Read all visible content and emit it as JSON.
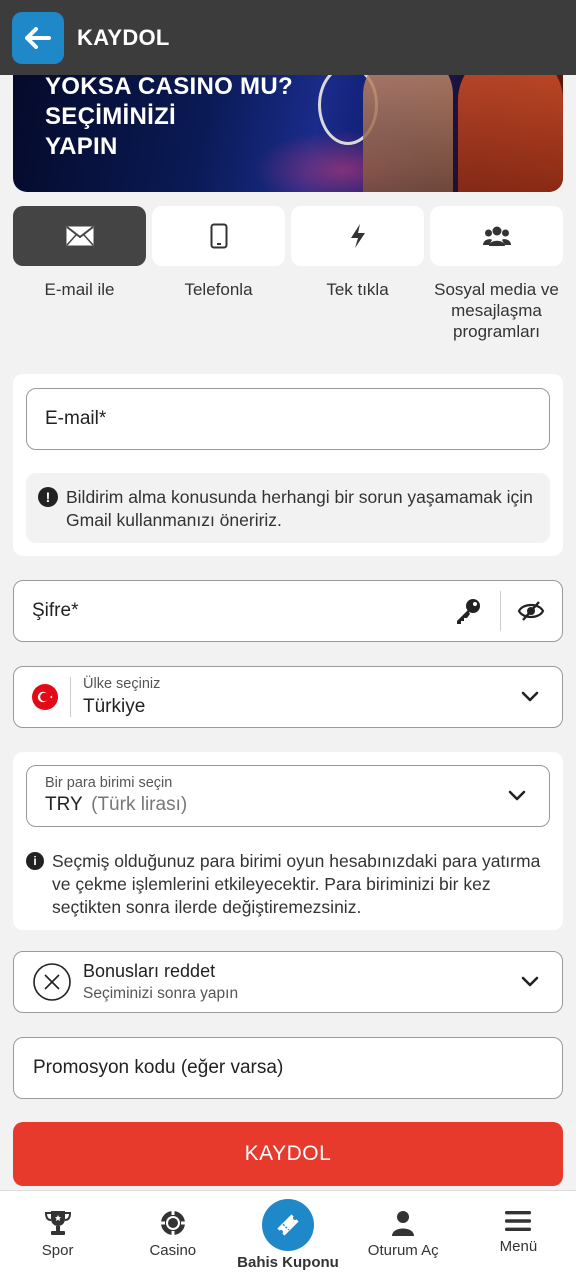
{
  "header": {
    "title": "KAYDOL"
  },
  "banner": {
    "line1": "YOKSA CASINO MU?",
    "line2": "SEÇİMİNİZİ",
    "line3": "YAPIN"
  },
  "tabs": [
    {
      "label": "E-mail ile",
      "icon": "envelope-icon",
      "active": true
    },
    {
      "label": "Telefonla",
      "icon": "phone-icon",
      "active": false
    },
    {
      "label": "Tek tıkla",
      "icon": "lightning-icon",
      "active": false
    },
    {
      "label": "Sosyal media ve mesajlaşma programları",
      "icon": "users-icon",
      "active": false
    }
  ],
  "email": {
    "placeholder": "E-mail*",
    "notice": "Bildirim alma konusunda herhangi bir sorun yaşamamak için Gmail kullanmanızı öneririz."
  },
  "password": {
    "placeholder": "Şifre*"
  },
  "country": {
    "label": "Ülke seçiniz",
    "value": "Türkiye"
  },
  "currency": {
    "label": "Bir para birimi seçin",
    "code": "TRY",
    "name": "(Türk lirası)",
    "notice": "Seçmiş olduğunuz para birimi oyun hesabınızdaki para yatırma ve çekme işlemlerini etkileyecektir. Para biriminizi bir kez seçtikten sonra ilerde değiştiremezsiniz."
  },
  "bonus": {
    "title": "Bonusları reddet",
    "subtitle": "Seçiminizi sonra yapın"
  },
  "promo": {
    "placeholder": "Promosyon kodu (eğer varsa)"
  },
  "submit_label": "KAYDOL",
  "nav": [
    {
      "label": "Spor",
      "icon": "trophy-icon"
    },
    {
      "label": "Casino",
      "icon": "casino-chip-icon"
    },
    {
      "label": "Bahis Kuponu",
      "icon": "ticket-icon"
    },
    {
      "label": "Oturum Aç",
      "icon": "user-icon"
    },
    {
      "label": "Menü",
      "icon": "menu-icon"
    }
  ],
  "colors": {
    "accent": "#1e88c8",
    "submit": "#e8392d",
    "header": "#3c3c3c"
  }
}
